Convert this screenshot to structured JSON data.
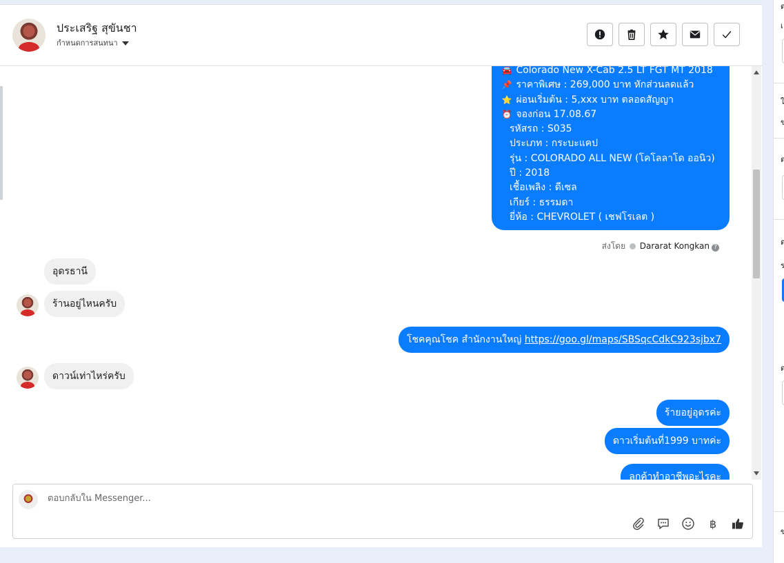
{
  "contact": {
    "name": "ประเสริฐ สุขันชา",
    "conversation_action": "กำหนดการสนทนา"
  },
  "actions": [
    {
      "name": "report-button",
      "icon": "alert-icon"
    },
    {
      "name": "delete-button",
      "icon": "trash-icon"
    },
    {
      "name": "star-button",
      "icon": "star-icon"
    },
    {
      "name": "mark-unread-button",
      "icon": "envelope-icon"
    },
    {
      "name": "mark-done-button",
      "icon": "check-icon"
    }
  ],
  "listing": {
    "lines": [
      {
        "icon": "🚘",
        "text": "Colorado New X-Cab 2.5 LT FGT MT 2018"
      },
      {
        "icon": "📌",
        "text": "ราคาพิเศษ : 269,000 บาท หักส่วนลดแล้ว"
      },
      {
        "icon": "⭐",
        "text": "ผ่อนเริ่มต้น : 5,xxx บาท ตลอดสัญญา"
      },
      {
        "icon": "⏰",
        "text": "จองก่อน 17.08.67"
      },
      {
        "icon": "",
        "text": "รหัสรถ : S035"
      },
      {
        "icon": "",
        "text": "ประเภท : กระบะแคป"
      },
      {
        "icon": "",
        "text": "รุ่น : COLORADO ALL NEW (โคโลลาโด ออนิว)"
      },
      {
        "icon": "",
        "text": "ปี : 2018"
      },
      {
        "icon": "",
        "text": "เชื้อเพลิง : ดีเซล"
      },
      {
        "icon": "",
        "text": "เกียร์ : ธรรมดา"
      },
      {
        "icon": "",
        "text": "ยี่ห้อ : CHEVROLET ( เชฟโรเลต )"
      }
    ]
  },
  "sent_by": {
    "label": "ส่งโดย",
    "agent": "Dararat Kongkan",
    "help": "?"
  },
  "messages": {
    "in_1": "อุดรธานี",
    "in_2": "ร้านอยู่ไหนครับ",
    "out_1_text": "โชคคุณโชค สำนักงานใหญ่ ",
    "out_1_link": "https://goo.gl/maps/SBSqcCdkC923sjbx7",
    "in_3": "ดาวน์เท่าไหร่ครับ",
    "out_2": "ร้ายอยู่อุดรค่ะ",
    "out_3": "ดาวเริ่มต้นที่1999 บาทค่ะ",
    "out_4": "ลูกค้าทำอาชีพอะไรคะ"
  },
  "composer": {
    "placeholder": "ตอบกลับใน Messenger...",
    "currency_symbol": "฿",
    "tools": [
      "paperclip-icon",
      "saved-reply-icon",
      "emoji-icon",
      "baht-icon",
      "thumbs-up-icon"
    ]
  },
  "right_panel_marks": [
    "ต",
    "เ",
    "ใ",
    "ข",
    "ต",
    "ต",
    "ร",
    "ต",
    "ข"
  ],
  "colors": {
    "outgoing_bubble": "#0a7cff",
    "incoming_bubble": "#f0f0f0",
    "page_background": "#e8eefa"
  }
}
